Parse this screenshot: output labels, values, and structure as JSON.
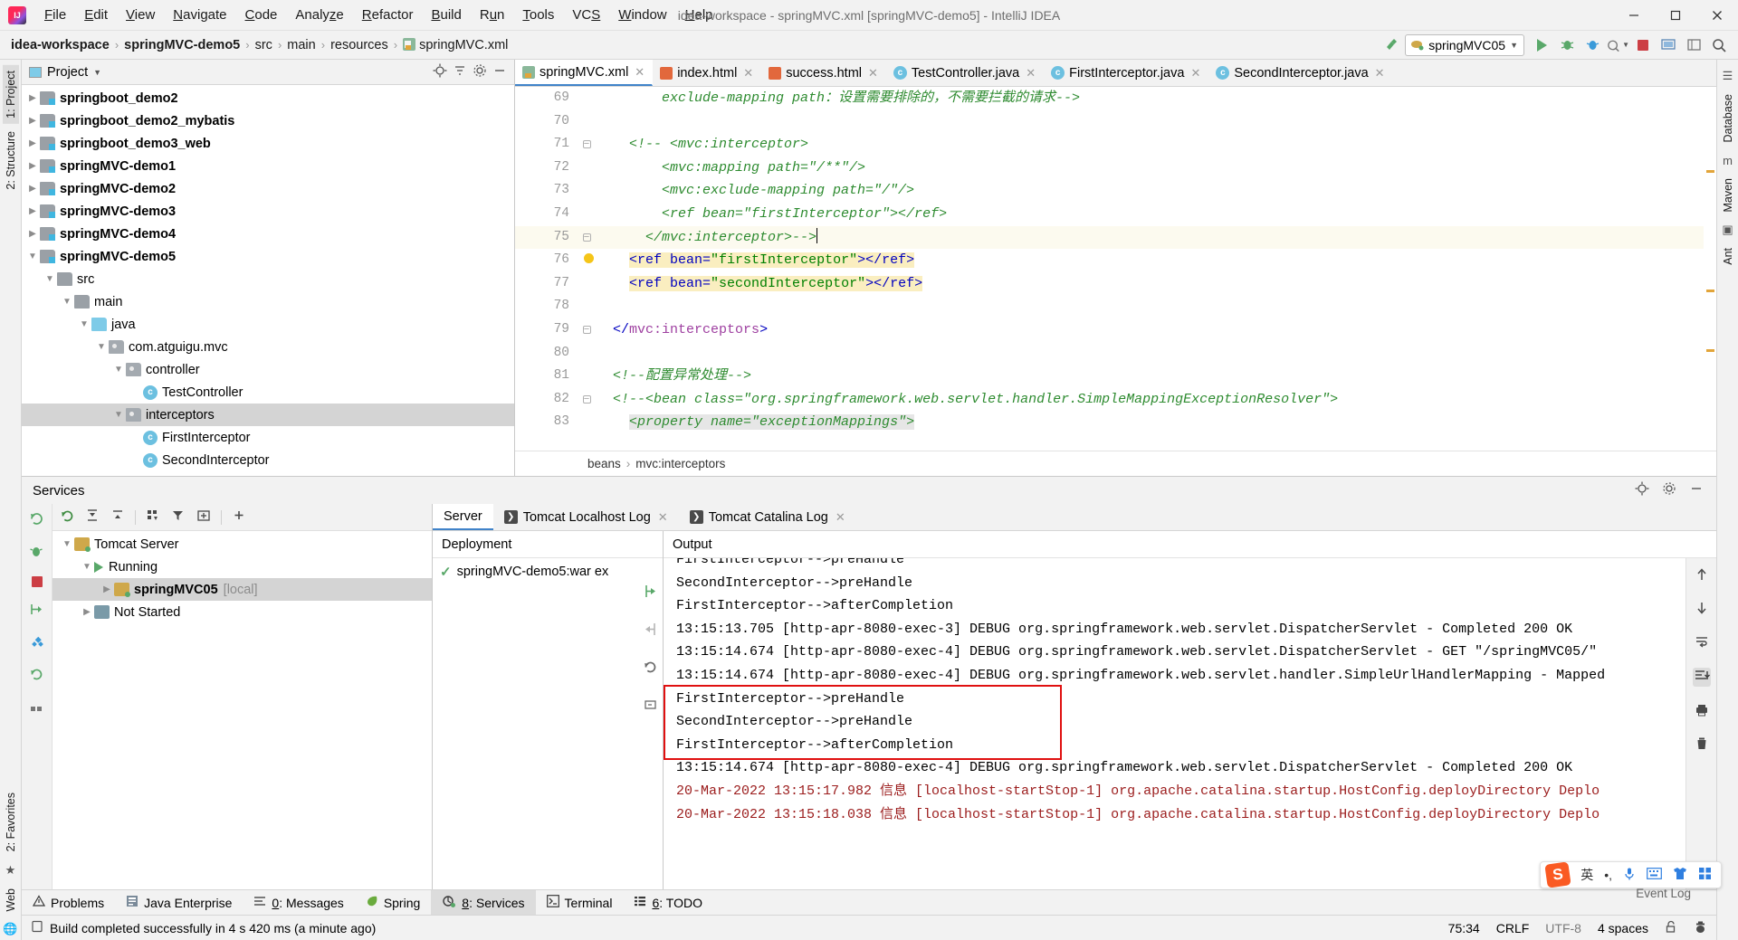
{
  "window": {
    "title": "idea-workspace - springMVC.xml [springMVC-demo5] - IntelliJ IDEA",
    "logo": "intellij-idea-logo",
    "minimize": "─",
    "maximize": "☐",
    "close": "✕"
  },
  "menu": [
    "File",
    "Edit",
    "View",
    "Navigate",
    "Code",
    "Analyze",
    "Refactor",
    "Build",
    "Run",
    "Tools",
    "VCS",
    "Window",
    "Help"
  ],
  "navbar": {
    "breadcrumbs": [
      "idea-workspace",
      "springMVC-demo5",
      "src",
      "main",
      "resources",
      "springMVC.xml"
    ],
    "run_config": "springMVC05",
    "separator": "›"
  },
  "project": {
    "panel_title": "Project",
    "tree": [
      {
        "label": "springboot_demo2",
        "depth": 1,
        "arrow": "collapsed",
        "icon": "module-icon",
        "bold": true
      },
      {
        "label": "springboot_demo2_mybatis",
        "depth": 1,
        "arrow": "collapsed",
        "icon": "module-icon",
        "bold": true
      },
      {
        "label": "springboot_demo3_web",
        "depth": 1,
        "arrow": "collapsed",
        "icon": "module-icon",
        "bold": true
      },
      {
        "label": "springMVC-demo1",
        "depth": 1,
        "arrow": "collapsed",
        "icon": "module-icon",
        "bold": true
      },
      {
        "label": "springMVC-demo2",
        "depth": 1,
        "arrow": "collapsed",
        "icon": "module-icon",
        "bold": true
      },
      {
        "label": "springMVC-demo3",
        "depth": 1,
        "arrow": "collapsed",
        "icon": "module-icon",
        "bold": true
      },
      {
        "label": "springMVC-demo4",
        "depth": 1,
        "arrow": "collapsed",
        "icon": "module-icon",
        "bold": true
      },
      {
        "label": "springMVC-demo5",
        "depth": 1,
        "arrow": "expanded",
        "icon": "module-icon",
        "bold": true
      },
      {
        "label": "src",
        "depth": 2,
        "arrow": "expanded",
        "icon": "folder-icon",
        "bold": false
      },
      {
        "label": "main",
        "depth": 3,
        "arrow": "expanded",
        "icon": "folder-icon",
        "bold": false
      },
      {
        "label": "java",
        "depth": 4,
        "arrow": "expanded",
        "icon": "source-folder-icon",
        "bold": false
      },
      {
        "label": "com.atguigu.mvc",
        "depth": 5,
        "arrow": "expanded",
        "icon": "package-icon",
        "bold": false
      },
      {
        "label": "controller",
        "depth": 6,
        "arrow": "expanded",
        "icon": "package-icon",
        "bold": false
      },
      {
        "label": "TestController",
        "depth": 7,
        "arrow": "none",
        "icon": "class-icon",
        "bold": false
      },
      {
        "label": "interceptors",
        "depth": 6,
        "arrow": "expanded",
        "icon": "package-icon",
        "bold": false,
        "selected": true
      },
      {
        "label": "FirstInterceptor",
        "depth": 7,
        "arrow": "none",
        "icon": "class-icon",
        "bold": false
      },
      {
        "label": "SecondInterceptor",
        "depth": 7,
        "arrow": "none",
        "icon": "class-icon",
        "bold": false
      }
    ]
  },
  "editor": {
    "tabs": [
      {
        "label": "springMVC.xml",
        "icon": "xml-file-icon",
        "active": true,
        "closable": true
      },
      {
        "label": "index.html",
        "icon": "html-file-icon",
        "active": false,
        "closable": true
      },
      {
        "label": "success.html",
        "icon": "html-file-icon",
        "active": false,
        "closable": true
      },
      {
        "label": "TestController.java",
        "icon": "java-class-icon",
        "active": false,
        "closable": true
      },
      {
        "label": "FirstInterceptor.java",
        "icon": "java-class-icon",
        "active": false,
        "closable": true
      },
      {
        "label": "SecondInterceptor.java",
        "icon": "java-class-icon",
        "active": false,
        "closable": true
      }
    ],
    "lines": [
      {
        "num": "69",
        "indent": 8,
        "segments": [
          {
            "t": "exclude-mapping path：设置需要排除的，不需要拦截的请求-->",
            "k": "cmt"
          }
        ]
      },
      {
        "num": "70",
        "indent": 0,
        "segments": []
      },
      {
        "num": "71",
        "indent": 4,
        "segments": [
          {
            "t": "<!-- <mvc:interceptor>",
            "k": "cmt"
          }
        ],
        "fold": "open"
      },
      {
        "num": "72",
        "indent": 8,
        "segments": [
          {
            "t": "<mvc:mapping path=\"/**\"/>",
            "k": "cmt"
          }
        ]
      },
      {
        "num": "73",
        "indent": 8,
        "segments": [
          {
            "t": "<mvc:exclude-mapping path=\"/\"/>",
            "k": "cmt"
          }
        ]
      },
      {
        "num": "74",
        "indent": 8,
        "segments": [
          {
            "t": "<ref bean=\"firstInterceptor\"></ref>",
            "k": "cmt"
          }
        ]
      },
      {
        "num": "75",
        "indent": 6,
        "segments": [
          {
            "t": "</mvc:interceptor>-->",
            "k": "cmt"
          }
        ],
        "fold": "close",
        "bulb": true,
        "current": true,
        "caret": true
      },
      {
        "num": "76",
        "indent": 4,
        "highlight": true,
        "segments": [
          {
            "t": "<ref ",
            "k": "tag"
          },
          {
            "t": "bean=",
            "k": "attr"
          },
          {
            "t": "\"firstInterceptor\"",
            "k": "val"
          },
          {
            "t": "></ref>",
            "k": "tag"
          }
        ]
      },
      {
        "num": "77",
        "indent": 4,
        "highlight": true,
        "segments": [
          {
            "t": "<ref ",
            "k": "tag"
          },
          {
            "t": "bean=",
            "k": "attr"
          },
          {
            "t": "\"secondInterceptor\"",
            "k": "val"
          },
          {
            "t": "></ref>",
            "k": "tag"
          }
        ]
      },
      {
        "num": "78",
        "indent": 0,
        "segments": []
      },
      {
        "num": "79",
        "indent": 2,
        "segments": [
          {
            "t": "</",
            "k": "tag"
          },
          {
            "t": "mvc:interceptors",
            "k": "ns"
          },
          {
            "t": ">",
            "k": "tag"
          }
        ],
        "fold": "close"
      },
      {
        "num": "80",
        "indent": 0,
        "segments": []
      },
      {
        "num": "81",
        "indent": 2,
        "segments": [
          {
            "t": "<!--配置异常处理-->",
            "k": "cmt"
          }
        ]
      },
      {
        "num": "82",
        "indent": 2,
        "segments": [
          {
            "t": "<!--<bean class=\"org.springframework.web.servlet.handler.SimpleMappingExceptionResolver\">",
            "k": "cmt"
          }
        ],
        "fold": "open"
      },
      {
        "num": "83",
        "indent": 4,
        "segments": [
          {
            "t": "<property name=\"exceptionMappings\">",
            "k": "cmt"
          }
        ],
        "greybg": true
      }
    ],
    "breadcrumb": [
      "beans",
      "mvc:interceptors"
    ],
    "breadcrumb_sep": "›"
  },
  "services": {
    "title": "Services",
    "toolbar_icons": [
      "rerun-icon",
      "expand-all-icon",
      "collapse-all-icon",
      "group-icon",
      "filter-icon",
      "add-tab-icon",
      "add-icon"
    ],
    "rail_icons": [
      "rerun-icon",
      "debug-icon",
      "stop-icon",
      "deploy-icon",
      "settings-icon",
      "refresh-icon",
      "grid-icon"
    ],
    "tree": [
      {
        "label": "Tomcat Server",
        "depth": 1,
        "arrow": "expanded",
        "icon": "tomcat-icon"
      },
      {
        "label": "Running",
        "depth": 2,
        "arrow": "expanded",
        "icon": "play-icon"
      },
      {
        "label": "springMVC05",
        "suffix": "[local]",
        "depth": 3,
        "arrow": "collapsed",
        "icon": "tomcat-icon",
        "selected": true,
        "bold": true
      },
      {
        "label": "Not Started",
        "depth": 2,
        "arrow": "collapsed",
        "icon": "wrench-icon"
      }
    ],
    "tabs": [
      {
        "label": "Server",
        "active": true,
        "icon": "none",
        "closable": false
      },
      {
        "label": "Tomcat Localhost Log",
        "active": false,
        "icon": "log-icon",
        "closable": true
      },
      {
        "label": "Tomcat Catalina Log",
        "active": false,
        "icon": "log-icon",
        "closable": true
      }
    ],
    "deployment": {
      "header": "Deployment",
      "item": "springMVC-demo5:war ex",
      "status": "✓",
      "side_icons": [
        "deploy-icon",
        "undeploy-icon",
        "redeploy-icon",
        "restart-icon"
      ]
    },
    "output": {
      "header": "Output",
      "lines": [
        {
          "text": "FirstInterceptor-->preHandle",
          "color": "black",
          "clipped": true
        },
        {
          "text": "SecondInterceptor-->preHandle",
          "color": "black"
        },
        {
          "text": "FirstInterceptor-->afterCompletion",
          "color": "black"
        },
        {
          "text": "13:15:13.705 [http-apr-8080-exec-3] DEBUG org.springframework.web.servlet.DispatcherServlet - Completed 200 OK",
          "color": "black"
        },
        {
          "text": "13:15:14.674 [http-apr-8080-exec-4] DEBUG org.springframework.web.servlet.DispatcherServlet - GET \"/springMVC05/\"",
          "color": "black"
        },
        {
          "text": "13:15:14.674 [http-apr-8080-exec-4] DEBUG org.springframework.web.servlet.handler.SimpleUrlHandlerMapping - Mapped",
          "color": "black"
        },
        {
          "text": "FirstInterceptor-->preHandle",
          "color": "black",
          "boxed": true
        },
        {
          "text": "SecondInterceptor-->preHandle",
          "color": "black",
          "boxed": true
        },
        {
          "text": "FirstInterceptor-->afterCompletion",
          "color": "black",
          "boxed": true
        },
        {
          "text": "13:15:14.674 [http-apr-8080-exec-4] DEBUG org.springframework.web.servlet.DispatcherServlet - Completed 200 OK",
          "color": "black"
        },
        {
          "text": "20-Mar-2022 13:15:17.982 信息 [localhost-startStop-1] org.apache.catalina.startup.HostConfig.deployDirectory Deplo",
          "color": "red"
        },
        {
          "text": "20-Mar-2022 13:15:18.038 信息 [localhost-startStop-1] org.apache.catalina.startup.HostConfig.deployDirectory Deplo",
          "color": "red"
        }
      ],
      "rail_icons": [
        "scroll-up-icon",
        "scroll-down-icon",
        "soft-wrap-icon",
        "scroll-to-end-icon",
        "print-icon",
        "trash-icon"
      ]
    }
  },
  "toolwindows": [
    {
      "label": "Problems",
      "icon": "warning-icon",
      "active": false,
      "mnemonic": ""
    },
    {
      "label": "Java Enterprise",
      "icon": "java-ee-icon",
      "active": false,
      "mnemonic": ""
    },
    {
      "label": "0: Messages",
      "icon": "messages-icon",
      "active": false,
      "mnemonic": "0"
    },
    {
      "label": "Spring",
      "icon": "spring-leaf-icon",
      "active": false,
      "mnemonic": ""
    },
    {
      "label": "8: Services",
      "icon": "services-icon",
      "active": true,
      "mnemonic": "8"
    },
    {
      "label": "Terminal",
      "icon": "terminal-icon",
      "active": false,
      "mnemonic": ""
    },
    {
      "label": "6: TODO",
      "icon": "todo-icon",
      "active": false,
      "mnemonic": "6"
    }
  ],
  "statusbar": {
    "message": "Build completed successfully in 4 s 420 ms (a minute ago)",
    "caret_position": "75:34",
    "line_separator": "CRLF",
    "encoding": "UTF-8",
    "indent": "4 spaces",
    "lock_icon": "unlocked-icon",
    "event_log": "Event Log"
  },
  "left_rail": [
    {
      "label": "1: Project",
      "selected": true
    },
    {
      "label": "2: Structure",
      "selected": false
    },
    {
      "label": "Ant",
      "selected": false
    }
  ],
  "left_rail_bottom": [
    {
      "label": "2: Favorites",
      "selected": false
    },
    {
      "label": "Web",
      "selected": false
    }
  ],
  "right_rail": [
    {
      "label": "Database",
      "selected": false
    },
    {
      "label": "Maven",
      "selected": false
    },
    {
      "label": "Ant",
      "selected": false
    }
  ],
  "ime": {
    "logo": "sogou-input-icon",
    "mode": "英",
    "punctuation": "•,",
    "mic": "microphone-icon",
    "keyboard": "keyboard-icon",
    "skin": "skin-icon",
    "toolbox": "toolbox-icon"
  },
  "colors": {
    "accent": "#4083c9",
    "comment_green": "#2e8b30",
    "tag_blue": "#0000c0",
    "string_green": "#008000",
    "highlight_yellow": "#faeec0",
    "error_red": "#e01010",
    "log_red": "#9b1c1c",
    "selection_grey": "#d4d4d4"
  }
}
